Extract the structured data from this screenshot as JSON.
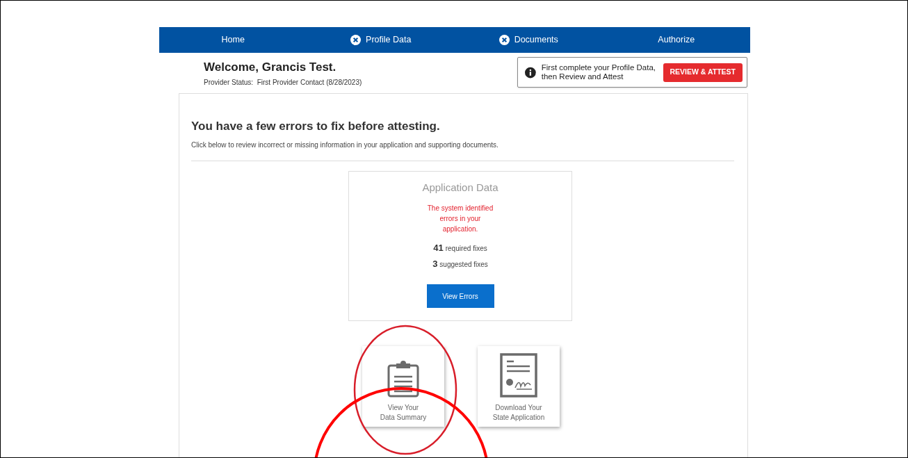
{
  "nav": [
    {
      "label": "Home",
      "error": false
    },
    {
      "label": "Profile Data",
      "error": true
    },
    {
      "label": "Documents",
      "error": true
    },
    {
      "label": "Authorize",
      "error": false
    }
  ],
  "header": {
    "welcome": "Welcome, Grancis Test.",
    "status": "Provider Status:  First Provider Contact (8/28/2023)"
  },
  "notice": {
    "text": "First complete your Profile Data, then Review and Attest",
    "button": "REVIEW & ATTEST"
  },
  "main": {
    "title": "You have a few errors to fix before attesting.",
    "subtitle": "Click below to review incorrect or missing information in your application and supporting documents."
  },
  "card": {
    "title": "Application Data",
    "message": "The system identified errors in your application.",
    "counts": [
      {
        "number": "41",
        "label": "required fixes"
      },
      {
        "number": "3",
        "label": "suggested fixes"
      }
    ],
    "button": "View Errors"
  },
  "tiles": [
    {
      "kind": "clipboard",
      "lines": [
        "View Your",
        "Data Summary"
      ]
    },
    {
      "kind": "certificate",
      "lines": [
        "Download Your",
        "State Application"
      ]
    }
  ]
}
